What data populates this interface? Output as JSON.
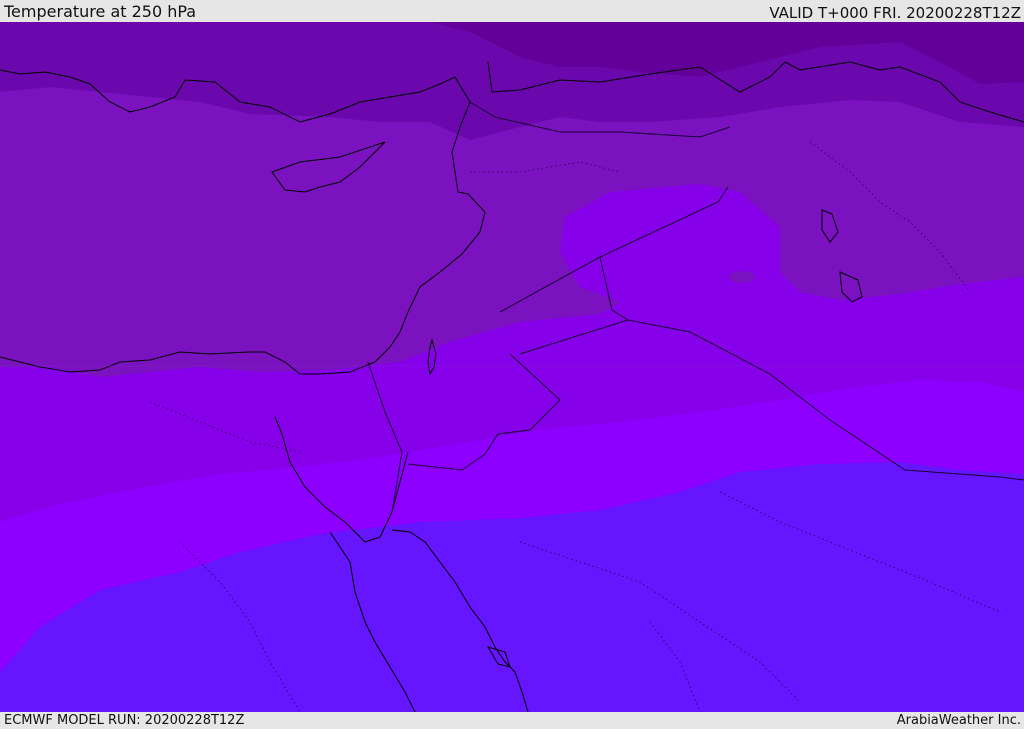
{
  "header": {
    "title": "Temperature at 250 hPa",
    "valid": "VALID T+000 FRI. 20200228T12Z"
  },
  "footer": {
    "model_run": "ECMWF MODEL RUN: 20200228T12Z",
    "credit": "ArabiaWeather Inc."
  },
  "map": {
    "field": "temperature",
    "level": "250 hPa",
    "colors": {
      "band_coldest": "#64009a",
      "band_cold": "#6a07ad",
      "band_mid": "#7b12c0",
      "band_warm": "#8600ea",
      "band_warmer": "#8d00ff",
      "band_warmest": "#6615ff",
      "coastline": "#000000",
      "border": "#1a0033"
    }
  }
}
